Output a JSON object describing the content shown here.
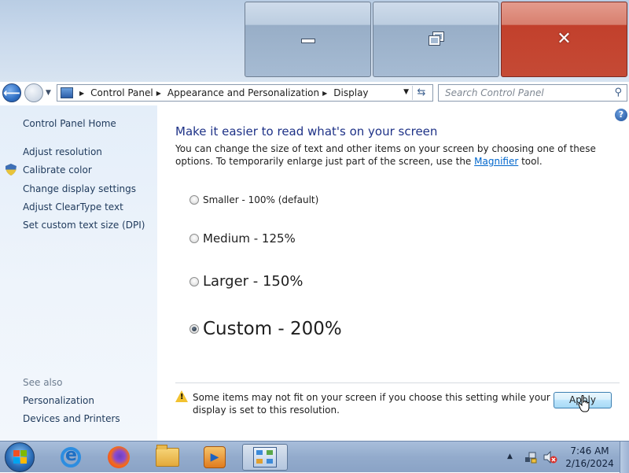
{
  "window": {
    "caption_buttons": {
      "minimize_icon": "minimize-icon",
      "maximize_icon": "restore-icon",
      "close_icon": "close-icon",
      "close_glyph": "✕"
    }
  },
  "navigation": {
    "breadcrumbs": [
      {
        "label": "Control Panel"
      },
      {
        "label": "Appearance and Personalization"
      },
      {
        "label": "Display"
      }
    ],
    "search_placeholder": "Search Control Panel"
  },
  "sidebar": {
    "home_link": "Control Panel Home",
    "links": [
      {
        "label": "Adjust resolution",
        "icon": null
      },
      {
        "label": "Calibrate color",
        "icon": "shield-icon"
      },
      {
        "label": "Change display settings",
        "icon": null
      },
      {
        "label": "Adjust ClearType text",
        "icon": null
      },
      {
        "label": "Set custom text size (DPI)",
        "icon": null
      }
    ],
    "see_also_label": "See also",
    "see_also_links": [
      {
        "label": "Personalization"
      },
      {
        "label": "Devices and Printers"
      }
    ]
  },
  "main": {
    "heading": "Make it easier to read what's on your screen",
    "description_before_link": "You can change the size of text and other items on your screen by choosing one of these options. To temporarily enlarge just part of the screen, use the ",
    "description_link": "Magnifier",
    "description_after_link": " tool.",
    "options": [
      {
        "label": "Smaller - 100% (default)",
        "selected": false
      },
      {
        "label": "Medium - 125%",
        "selected": false
      },
      {
        "label": "Larger - 150%",
        "selected": false
      },
      {
        "label": "Custom - 200%",
        "selected": true
      }
    ],
    "warning_text": "Some items may not fit on your screen if you choose this setting while your display is set to this resolution.",
    "apply_label": "Apply"
  },
  "taskbar": {
    "pinned": [
      {
        "name": "internet-explorer-icon"
      },
      {
        "name": "firefox-icon"
      },
      {
        "name": "file-explorer-icon"
      },
      {
        "name": "media-player-icon"
      },
      {
        "name": "control-panel-icon",
        "active": true
      }
    ],
    "clock_time": "7:46 AM",
    "clock_date": "2/16/2024"
  },
  "colors": {
    "heading": "#1e3287",
    "link": "#0066cc",
    "close_button": "#c2402c",
    "sidebar_link": "#1e395b"
  }
}
